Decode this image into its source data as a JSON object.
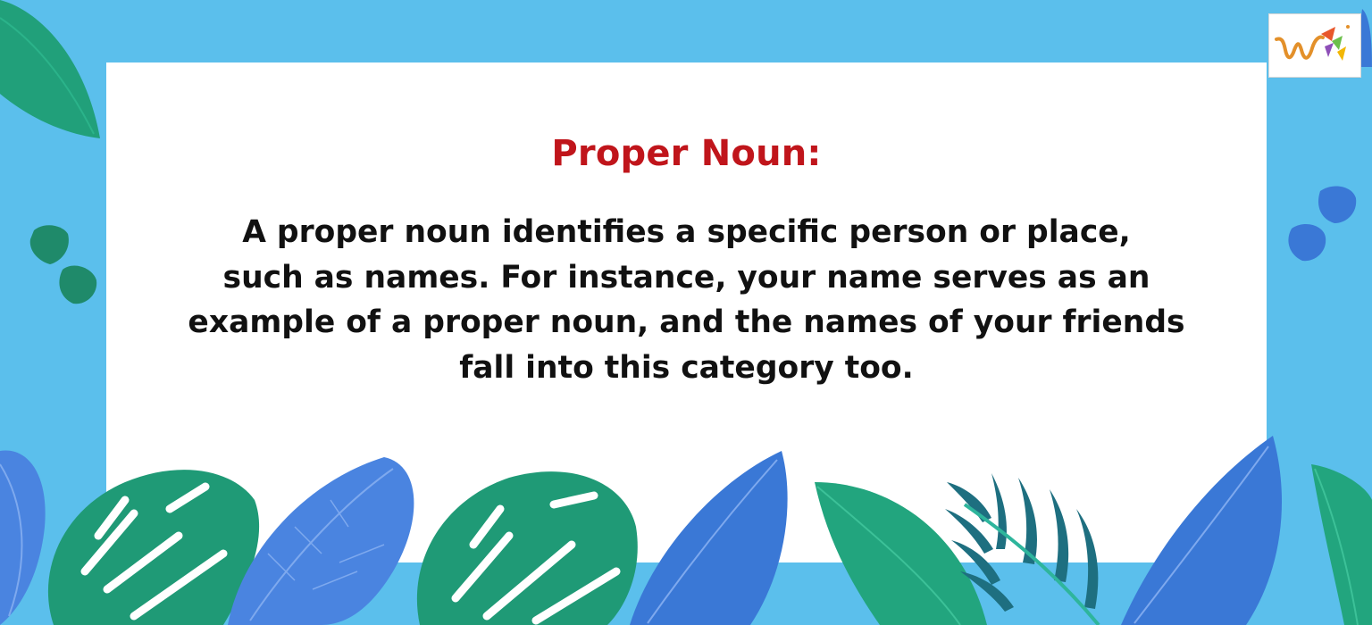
{
  "card": {
    "title": "Proper Noun:",
    "lines": [
      "A proper noun identifies a specific person or place,",
      "such as names. For instance, your name serves as an",
      "example of a proper noun, and the names of your friends",
      "fall into this category too."
    ]
  },
  "logo": {
    "icon": "w-logo-icon"
  },
  "colors": {
    "background": "#5bbfec",
    "title": "#c0151b",
    "text": "#111111",
    "leaf_green": "#1f9a76",
    "leaf_blue": "#3a78d6"
  }
}
